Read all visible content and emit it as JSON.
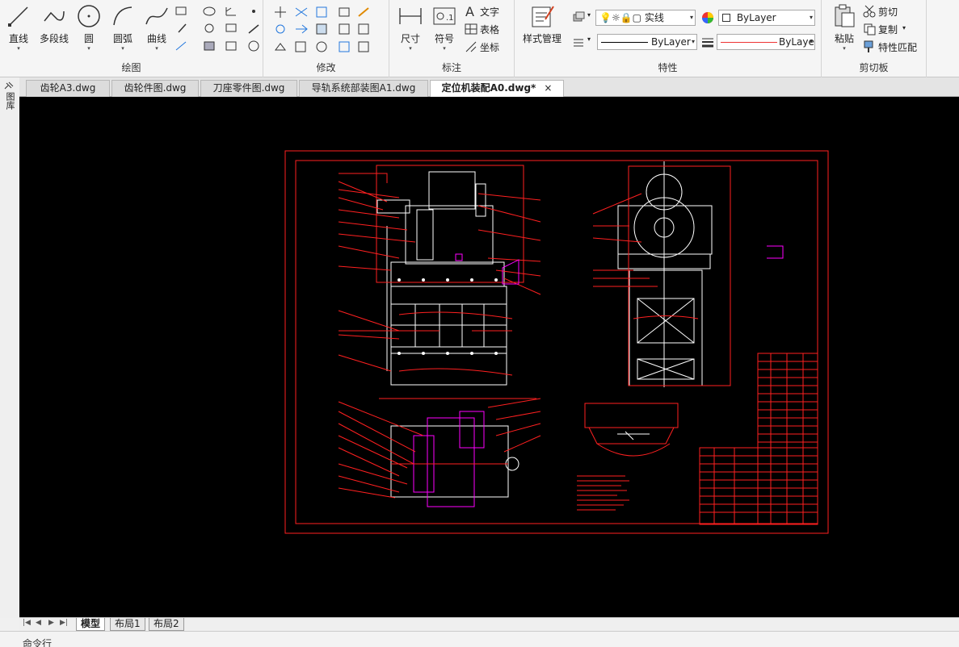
{
  "ribbon": {
    "draw": {
      "title": "绘图",
      "buttons": [
        "直线",
        "多段线",
        "圆",
        "圆弧",
        "曲线"
      ]
    },
    "modify": {
      "title": "修改"
    },
    "annotate": {
      "title": "标注",
      "buttons": [
        "尺寸",
        "符号"
      ],
      "small": [
        "文字",
        "表格",
        "坐标"
      ]
    },
    "properties": {
      "title": "特性",
      "style_button": "样式管理",
      "layer_combo": "实线",
      "color_combo": "ByLayer",
      "linetype_combo": "ByLayer",
      "lineweight_combo": "ByLayer"
    },
    "clipboard": {
      "title": "剪切板",
      "paste": "粘贴",
      "cut": "剪切",
      "copy": "复制",
      "match": "特性匹配"
    }
  },
  "file_tabs": [
    "齿轮A3.dwg",
    "齿轮件图.dwg",
    "刀座零件图.dwg",
    "导轨系统部装图A1.dwg",
    "定位机装配A0.dwg*"
  ],
  "active_tab_close": "×",
  "sidebar": {
    "label": "图库"
  },
  "layout_tabs": [
    "模型",
    "布局1",
    "布局2"
  ],
  "command": {
    "label": "命令行"
  },
  "colors": {
    "canvas": "#000000",
    "drawing_red": "#ff2020",
    "drawing_white": "#ffffff",
    "drawing_magenta": "#ff00ff"
  }
}
